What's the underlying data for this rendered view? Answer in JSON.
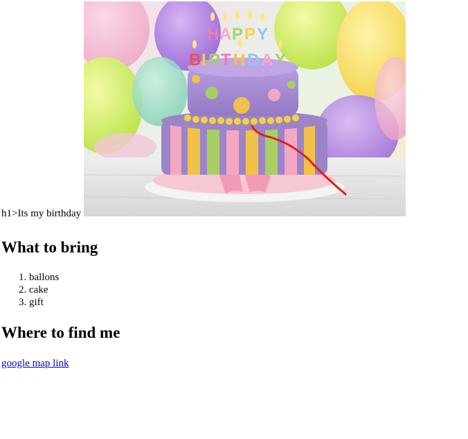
{
  "header": {
    "intro_text": "h1>Its my birthday",
    "photo": {
      "subject": "birthday-cake-photo",
      "candle_text": "HAPPY BIRTHDAY",
      "colors": {
        "cake_top": "#a68bd4",
        "cake_bottom": "#9d84c8",
        "stripe_pink": "#f3a7c3",
        "stripe_green": "#a8cf63",
        "stripe_yellow": "#f1c24a",
        "board": "#f7c8d4",
        "annotation": "#d9221b"
      }
    }
  },
  "bring_section": {
    "heading": "What to bring",
    "items": [
      "ballons",
      "cake",
      "gift"
    ]
  },
  "find_section": {
    "heading": "Where to find me",
    "link_text": "google map link",
    "link_color": "#0000ee"
  }
}
